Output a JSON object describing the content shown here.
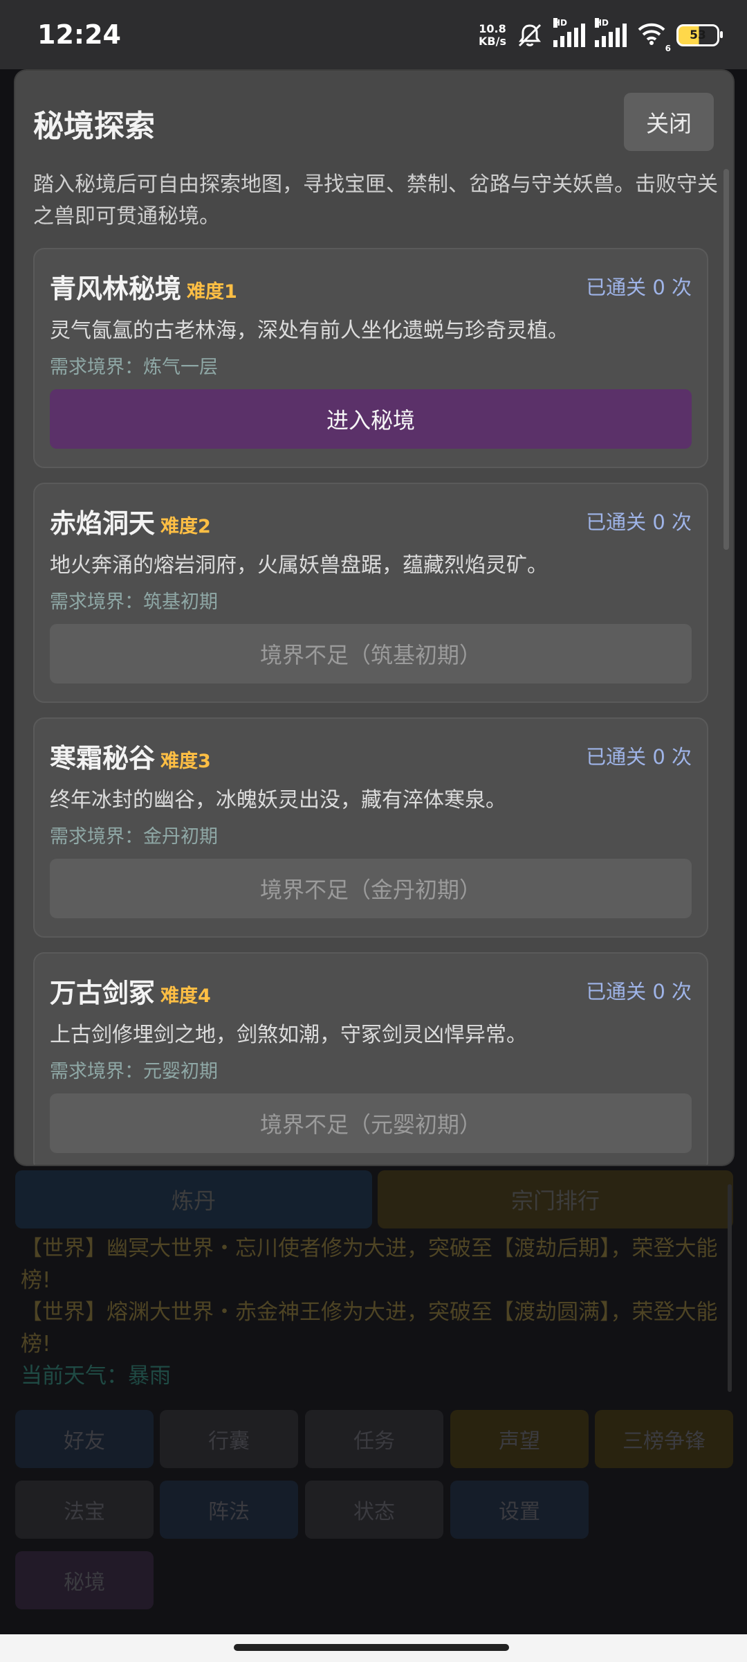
{
  "status_bar": {
    "time": "12:24",
    "net_speed_value": "10.8",
    "net_speed_unit": "KB/s",
    "sim1_label": "HD",
    "sim2_label": "HD",
    "wifi_sub": "6",
    "battery": "53",
    "battery_level_pct": 53
  },
  "background": {
    "buttons_row": [
      {
        "label": "炼丹",
        "color": "#14202e"
      },
      {
        "label": "宗门排行",
        "color": "#2a2412"
      }
    ],
    "log_lines": [
      "【世界】幽冥大世界・忘川使者修为大进，突破至【渡劫后期】，荣登大能榜!",
      "【世界】熔渊大世界・赤金神王修为大进，突破至【渡劫圆满】，荣登大能榜!"
    ],
    "weather": "当前天气：暴雨",
    "grid_buttons": [
      {
        "label": "好友",
        "color": "#151d29"
      },
      {
        "label": "行囊",
        "color": "#1f1f22"
      },
      {
        "label": "任务",
        "color": "#1f1f22"
      },
      {
        "label": "声望",
        "color": "#29230f"
      },
      {
        "label": "三榜争锋",
        "color": "#29230f"
      },
      {
        "label": "法宝",
        "color": "#1f1f22"
      },
      {
        "label": "阵法",
        "color": "#151d29"
      },
      {
        "label": "状态",
        "color": "#1f1f22"
      },
      {
        "label": "设置",
        "color": "#151d29"
      },
      {
        "label": "秘境",
        "color": "#221a28"
      }
    ]
  },
  "modal": {
    "title": "秘境探索",
    "close_label": "关闭",
    "description": "踏入秘境后可自由探索地图，寻找宝匣、禁制、岔路与守关妖兽。击败守关之兽即可贯通秘境。",
    "realms": [
      {
        "name": "青风林秘境",
        "difficulty": "难度1",
        "cleared": "已通关 0 次",
        "desc": "灵气氤氲的古老林海，深处有前人坐化遗蜕与珍奇灵植。",
        "requirement": "需求境界：炼气一层",
        "button": "进入秘境",
        "enabled": true
      },
      {
        "name": "赤焰洞天",
        "difficulty": "难度2",
        "cleared": "已通关 0 次",
        "desc": "地火奔涌的熔岩洞府，火属妖兽盘踞，蕴藏烈焰灵矿。",
        "requirement": "需求境界：筑基初期",
        "button": "境界不足（筑基初期）",
        "enabled": false
      },
      {
        "name": "寒霜秘谷",
        "difficulty": "难度3",
        "cleared": "已通关 0 次",
        "desc": "终年冰封的幽谷，冰魄妖灵出没，藏有淬体寒泉。",
        "requirement": "需求境界：金丹初期",
        "button": "境界不足（金丹初期）",
        "enabled": false
      },
      {
        "name": "万古剑冢",
        "difficulty": "难度4",
        "cleared": "已通关 0 次",
        "desc": "上古剑修埋剑之地，剑煞如潮，守冢剑灵凶悍异常。",
        "requirement": "需求境界：元婴初期",
        "button": "境界不足（元婴初期）",
        "enabled": false
      }
    ]
  }
}
